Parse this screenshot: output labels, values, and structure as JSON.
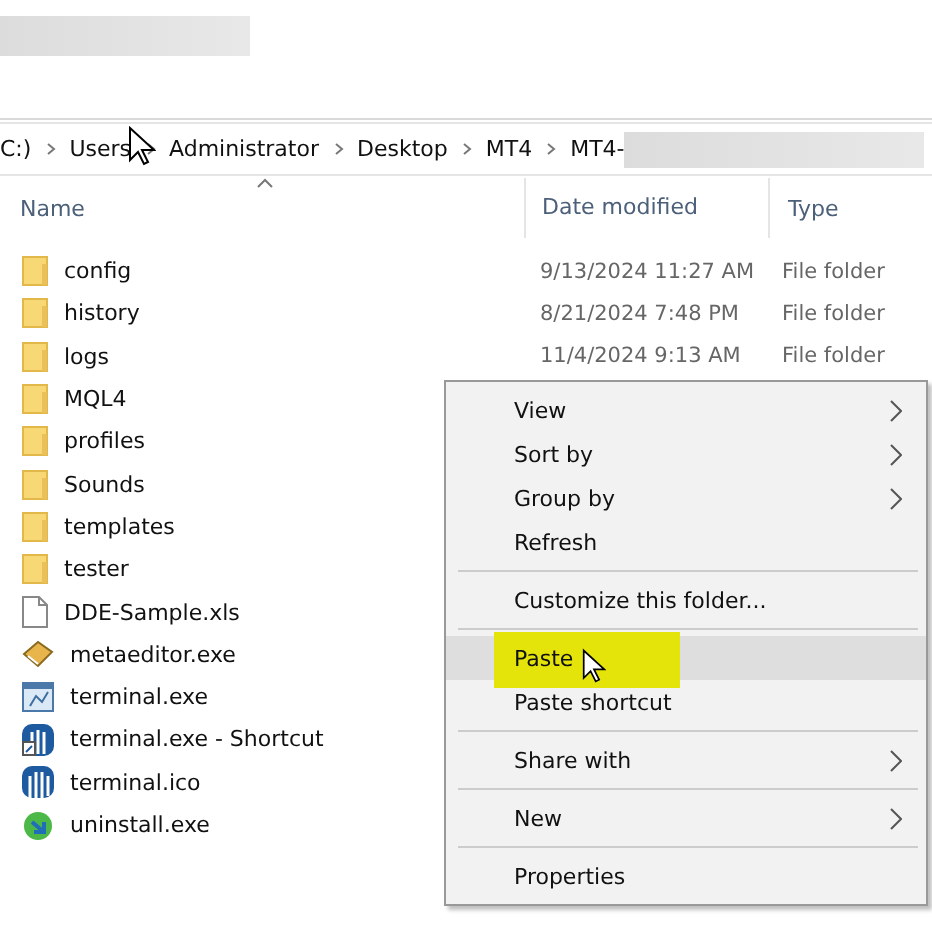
{
  "breadcrumb": [
    "C:)",
    "Users",
    "Administrator",
    "Desktop",
    "MT4",
    "MT4-"
  ],
  "columns": [
    "Name",
    "Date modified",
    "Type"
  ],
  "files": [
    {
      "name": "config",
      "kind": "folder",
      "date": "9/13/2024 11:27 AM",
      "type": "File folder"
    },
    {
      "name": "history",
      "kind": "folder",
      "date": "8/21/2024 7:48 PM",
      "type": "File folder"
    },
    {
      "name": "logs",
      "kind": "folder",
      "date": "11/4/2024 9:13 AM",
      "type": "File folder"
    },
    {
      "name": "MQL4",
      "kind": "folder"
    },
    {
      "name": "profiles",
      "kind": "folder"
    },
    {
      "name": "Sounds",
      "kind": "folder"
    },
    {
      "name": "templates",
      "kind": "folder"
    },
    {
      "name": "tester",
      "kind": "folder"
    },
    {
      "name": "DDE-Sample.xls",
      "kind": "document"
    },
    {
      "name": "metaeditor.exe",
      "kind": "editor"
    },
    {
      "name": "terminal.exe",
      "kind": "app"
    },
    {
      "name": "terminal.exe - Shortcut",
      "kind": "shortcut"
    },
    {
      "name": "terminal.ico",
      "kind": "chart"
    },
    {
      "name": "uninstall.exe",
      "kind": "installer"
    }
  ],
  "context_menu": [
    {
      "kind": "item",
      "label": "View",
      "submenu": true,
      "selected": false
    },
    {
      "kind": "item",
      "label": "Sort by",
      "submenu": true,
      "selected": false
    },
    {
      "kind": "item",
      "label": "Group by",
      "submenu": true,
      "selected": false
    },
    {
      "kind": "item",
      "label": "Refresh",
      "submenu": false,
      "selected": false
    },
    {
      "kind": "separator"
    },
    {
      "kind": "item",
      "label": "Customize this folder...",
      "submenu": false,
      "selected": false
    },
    {
      "kind": "separator"
    },
    {
      "kind": "item",
      "label": "Paste",
      "submenu": false,
      "selected": true
    },
    {
      "kind": "item",
      "label": "Paste shortcut",
      "submenu": false,
      "selected": false
    },
    {
      "kind": "separator"
    },
    {
      "kind": "item",
      "label": "Share with",
      "submenu": true,
      "selected": false
    },
    {
      "kind": "separator"
    },
    {
      "kind": "item",
      "label": "New",
      "submenu": true,
      "selected": false
    },
    {
      "kind": "separator"
    },
    {
      "kind": "item",
      "label": "Properties",
      "submenu": false,
      "selected": false
    }
  ]
}
